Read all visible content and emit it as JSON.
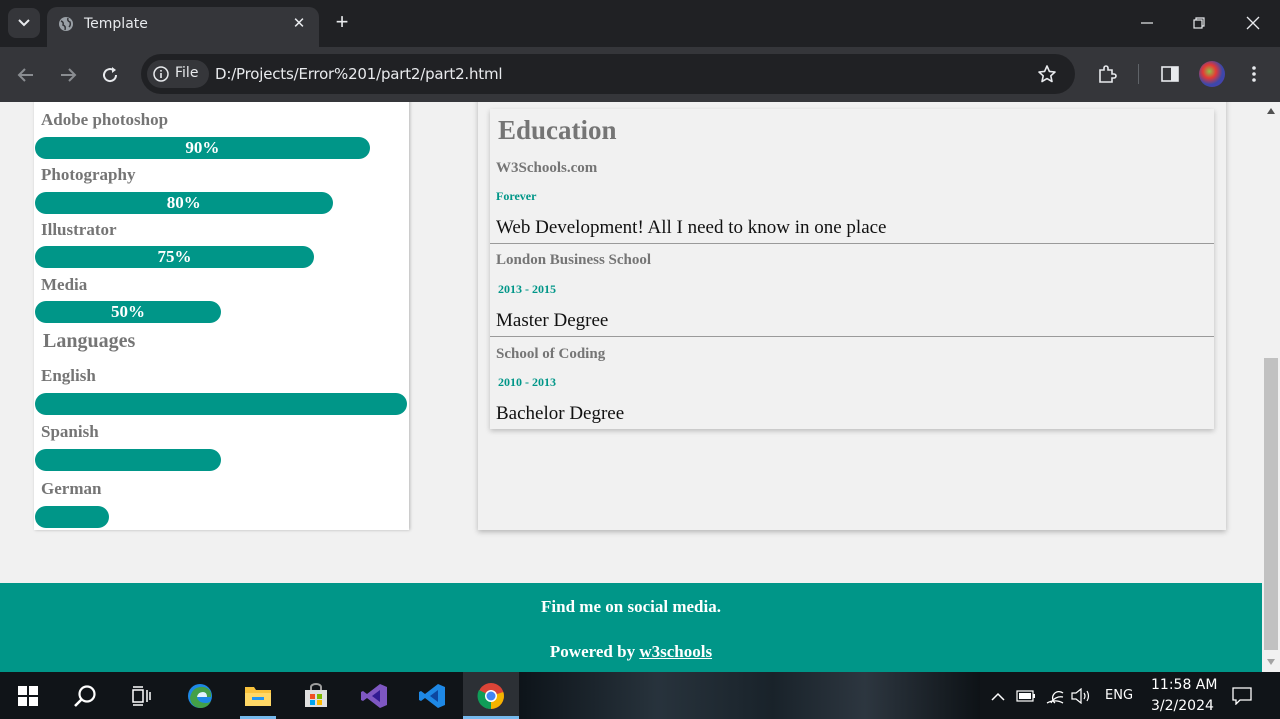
{
  "browser": {
    "tab_title": "Template",
    "chip_label": "File",
    "url": "D:/Projects/Error%201/part2/part2.html"
  },
  "skills": [
    {
      "label": "Adobe photoshop",
      "percent": "90%",
      "level": 90
    },
    {
      "label": "Photography",
      "percent": "80%",
      "level": 80
    },
    {
      "label": "Illustrator",
      "percent": "75%",
      "level": 75
    },
    {
      "label": "Media",
      "percent": "50%",
      "level": 50
    }
  ],
  "languages": {
    "heading": "Languages",
    "items": [
      {
        "label": "English",
        "level": 100
      },
      {
        "label": "Spanish",
        "level": 50
      },
      {
        "label": "German",
        "level": 20
      }
    ]
  },
  "education": {
    "title": "Education",
    "entries": [
      {
        "school": "W3Schools.com",
        "date": "Forever",
        "desc": "Web Development! All I need to know in one place"
      },
      {
        "school": "London Business School",
        "date": "2013 - 2015",
        "desc": "Master Degree"
      },
      {
        "school": "School of Coding",
        "date": "2010 - 2013",
        "desc": "Bachelor Degree"
      }
    ]
  },
  "footer": {
    "social": "Find me on social media.",
    "powered_prefix": "Powered by",
    "powered_link": "w3schools"
  },
  "taskbar": {
    "language": "ENG",
    "time": "11:58 AM",
    "date": "3/2/2024"
  },
  "colors": {
    "accent": "#009688",
    "chrome_dark": "#202124",
    "chrome_toolbar": "#35363a"
  }
}
